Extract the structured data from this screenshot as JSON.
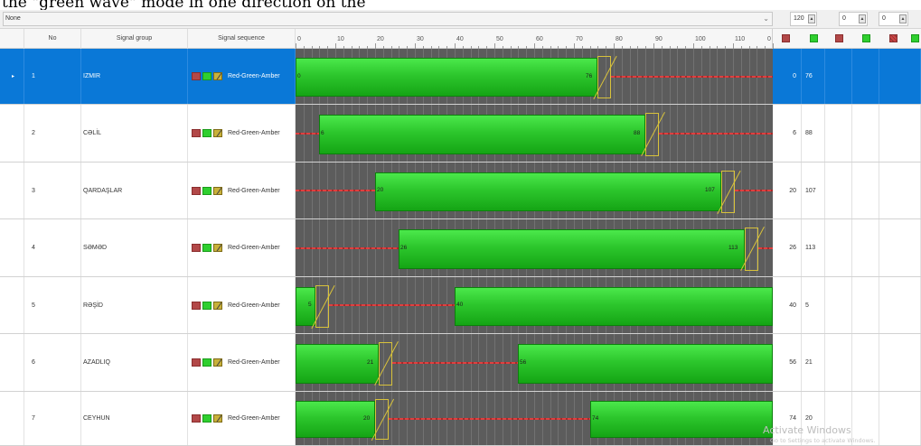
{
  "caption": "the \"green wave\" mode in one direction on the",
  "toolbar": {
    "program_select": "None",
    "cycle_value": "120",
    "offset1_value": "0",
    "offset2_value": "0"
  },
  "columns": {
    "no": "No",
    "signal_group": "Signal group",
    "signal_sequence": "Signal sequence"
  },
  "ruler": {
    "max_seconds": 120,
    "ticks": [
      {
        "t": 0,
        "label": "0"
      },
      {
        "t": 10,
        "label": "10"
      },
      {
        "t": 20,
        "label": "20"
      },
      {
        "t": 30,
        "label": "30"
      },
      {
        "t": 40,
        "label": "40"
      },
      {
        "t": 50,
        "label": "50"
      },
      {
        "t": 60,
        "label": "60"
      },
      {
        "t": 70,
        "label": "70"
      },
      {
        "t": 80,
        "label": "80"
      },
      {
        "t": 90,
        "label": "90"
      },
      {
        "t": 100,
        "label": "100"
      },
      {
        "t": 110,
        "label": "110"
      },
      {
        "t": 120,
        "label": "0"
      }
    ]
  },
  "header_icons": [
    "red-square-icon",
    "green-square-icon",
    "red-square-icon",
    "green-square-icon",
    "red-dotted-icon",
    "green-square-icon",
    "amber-square-icon"
  ],
  "colors": {
    "selection": "#0a78d7",
    "green": "#2cc62c",
    "red": "#e04040",
    "amber": "#d8c23b",
    "timeline_bg": "#5c5c5c"
  },
  "rows": [
    {
      "no": "1",
      "name": "IZMIR",
      "sequence": "Red-Green-Amber",
      "green_start": 0,
      "green_end": 76,
      "start_label": "0",
      "end_label": "76",
      "selected": true
    },
    {
      "no": "2",
      "name": "CƏLİL",
      "sequence": "Red-Green-Amber",
      "green_start": 6,
      "green_end": 88,
      "start_label": "6",
      "end_label": "88",
      "selected": false
    },
    {
      "no": "3",
      "name": "QARDAŞLAR",
      "sequence": "Red-Green-Amber",
      "green_start": 20,
      "green_end": 107,
      "start_label": "20",
      "end_label": "107",
      "selected": false
    },
    {
      "no": "4",
      "name": "SƏMƏD",
      "sequence": "Red-Green-Amber",
      "green_start": 26,
      "green_end": 113,
      "start_label": "26",
      "end_label": "113",
      "selected": false
    },
    {
      "no": "5",
      "name": "RƏŞİD",
      "sequence": "Red-Green-Amber",
      "green_start": 40,
      "green_end": 5,
      "start_label": "40",
      "end_label": "5",
      "selected": false
    },
    {
      "no": "6",
      "name": "AZADLIQ",
      "sequence": "Red-Green-Amber",
      "green_start": 56,
      "green_end": 21,
      "start_label": "56",
      "end_label": "21",
      "selected": false
    },
    {
      "no": "7",
      "name": "CEYHUN",
      "sequence": "Red-Green-Amber",
      "green_start": 74,
      "green_end": 20,
      "start_label": "74",
      "end_label": "20",
      "selected": false
    }
  ],
  "watermark": {
    "title": "Activate Windows",
    "subtitle": "Go to Settings to activate Windows."
  }
}
